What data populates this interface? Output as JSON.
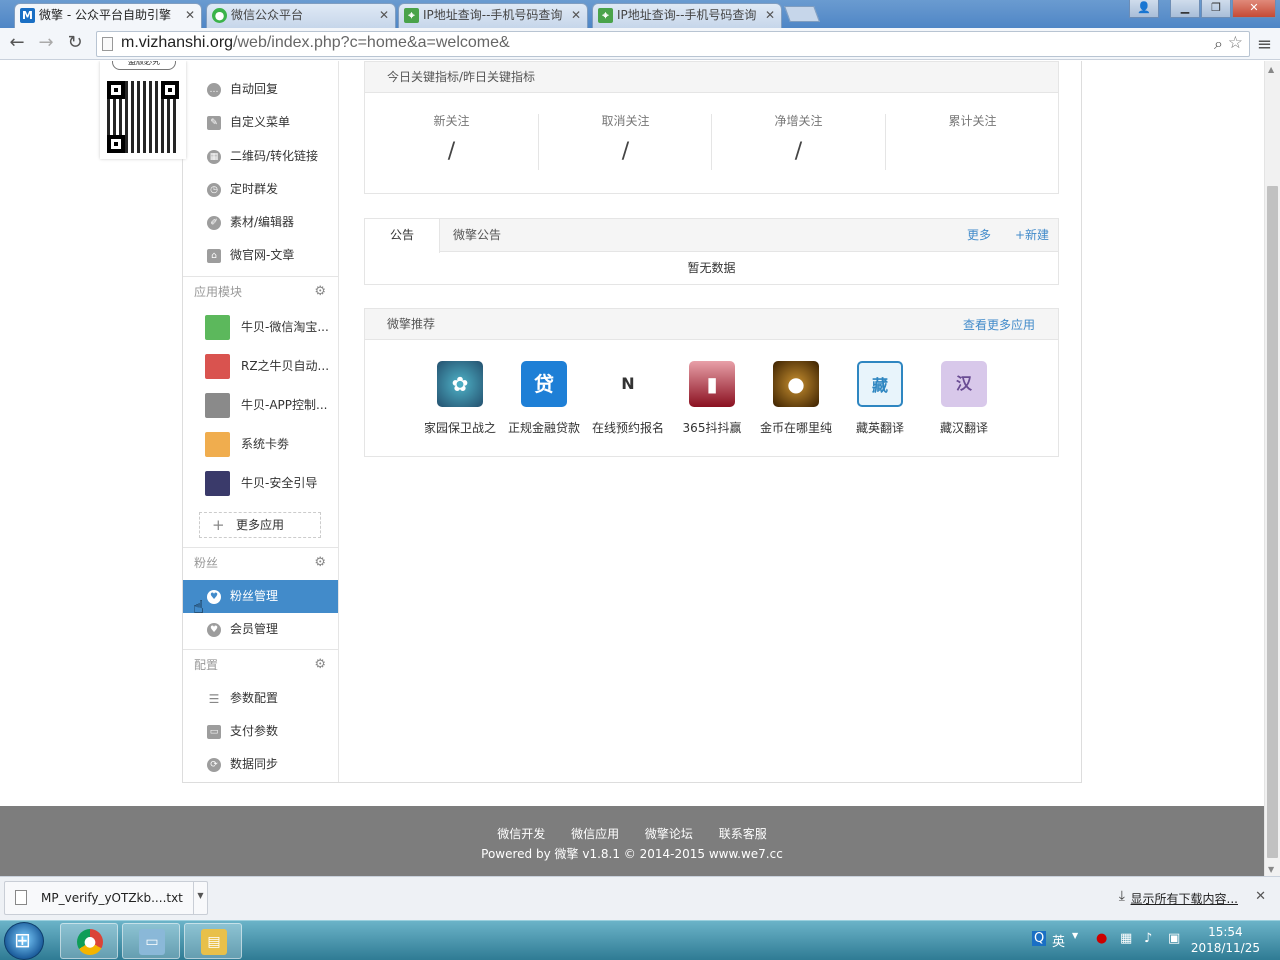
{
  "browser": {
    "tabs": [
      {
        "title": "微擎 - 公众平台自助引擎",
        "favicon": "M"
      },
      {
        "title": "微信公众平台",
        "favicon": "wechat"
      },
      {
        "title": "IP地址查询--手机号码查询",
        "favicon": "map"
      },
      {
        "title": "IP地址查询--手机号码查询",
        "favicon": "map"
      }
    ],
    "url_domain": "m.vizhanshi.org",
    "url_path": "/web/index.php?c=home&a=welcome&"
  },
  "qr": {
    "tag": "盗版必究"
  },
  "sidebar": {
    "top_items": [
      {
        "label": "自动回复",
        "icon": "chat-icon"
      },
      {
        "label": "自定义菜单",
        "icon": "edit-icon"
      },
      {
        "label": "二维码/转化链接",
        "icon": "qrcode-icon"
      },
      {
        "label": "定时群发",
        "icon": "clock-icon"
      },
      {
        "label": "素材/编辑器",
        "icon": "pencil-icon"
      },
      {
        "label": "微官网-文章",
        "icon": "home-icon"
      }
    ],
    "apps_header": "应用模块",
    "apps": [
      {
        "label": "牛贝-微信淘宝...",
        "color": "#5cb85c"
      },
      {
        "label": "RZ之牛贝自动...",
        "color": "#d9534f"
      },
      {
        "label": "牛贝-APP控制...",
        "color": "#8a8a8a"
      },
      {
        "label": "系统卡劵",
        "color": "#f0ad4e"
      },
      {
        "label": "牛贝-安全引导",
        "color": "#3a3a6a"
      }
    ],
    "more_apps": "更多应用",
    "fans_header": "粉丝",
    "fans_items": [
      {
        "label": "粉丝管理",
        "icon": "heart-icon",
        "active": true
      },
      {
        "label": "会员管理",
        "icon": "heart-icon",
        "active": false
      }
    ],
    "config_header": "配置",
    "config_items": [
      {
        "label": "参数配置",
        "icon": "list-icon"
      },
      {
        "label": "支付参数",
        "icon": "wallet-icon"
      },
      {
        "label": "数据同步",
        "icon": "sync-icon"
      }
    ]
  },
  "stats": {
    "header": "今日关键指标/昨日关键指标",
    "items": [
      {
        "label": "新关注",
        "value": "/"
      },
      {
        "label": "取消关注",
        "value": "/"
      },
      {
        "label": "净增关注",
        "value": "/"
      },
      {
        "label": "累计关注",
        "value": ""
      }
    ]
  },
  "notice": {
    "tabs": [
      "公告",
      "微擎公告"
    ],
    "more": "更多",
    "new": "+新建",
    "empty": "暂无数据"
  },
  "recommend": {
    "header": "微擎推荐",
    "more": "查看更多应用",
    "apps": [
      {
        "name": "家园保卫战之",
        "color": "#2f6f8f",
        "glyph": "✿"
      },
      {
        "name": "正规金融贷款",
        "color": "#1e7fd6",
        "glyph": "贷"
      },
      {
        "name": "在线预约报名",
        "color": "#ffffff",
        "glyph": "N"
      },
      {
        "name": "365抖抖赢",
        "color": "#b0203a",
        "glyph": "▮"
      },
      {
        "name": "金币在哪里纯",
        "color": "#8a5a10",
        "glyph": "●"
      },
      {
        "name": "藏英翻译",
        "color": "#2e86c1",
        "glyph": "藏"
      },
      {
        "name": "藏汉翻译",
        "color": "#a98bc9",
        "glyph": "汉"
      }
    ]
  },
  "footer": {
    "links": [
      "微信开发",
      "微信应用",
      "微擎论坛",
      "联系客服"
    ],
    "powered": "Powered by 微擎 v1.8.1 © 2014-2015 www.we7.cc"
  },
  "downloads": {
    "file": "MP_verify_yOTZkb....txt",
    "show_all": "显示所有下载内容..."
  },
  "taskbar": {
    "ime": "英",
    "time": "15:54",
    "date": "2018/11/25"
  }
}
